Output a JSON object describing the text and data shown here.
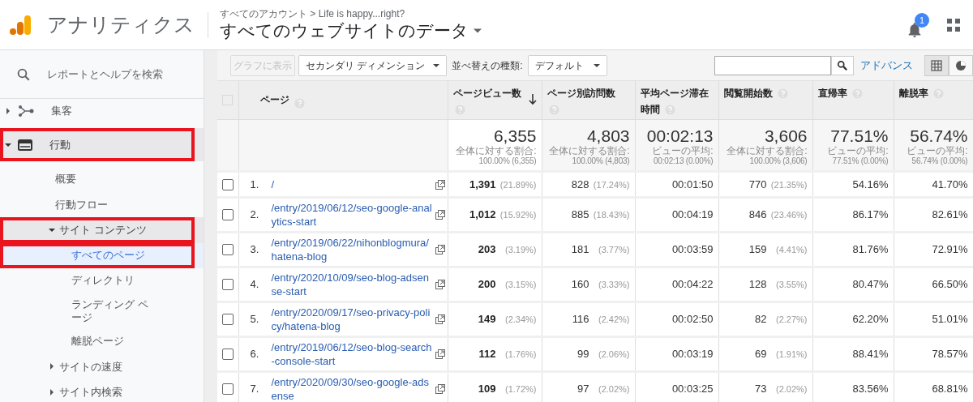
{
  "header": {
    "app_name": "アナリティクス",
    "breadcrumb": "すべてのアカウント > Life is happy...right?",
    "view_title": "すべてのウェブサイトのデータ",
    "notification_count": "1"
  },
  "sidebar": {
    "search": {
      "placeholder": "レポートとヘルプを検索"
    },
    "items": [
      {
        "label": "集客",
        "expanded": false,
        "selected": false,
        "highlighted": false
      },
      {
        "label": "行動",
        "expanded": true,
        "selected": false,
        "highlighted": true,
        "children": [
          {
            "label": "概要",
            "selected": false,
            "highlighted": false
          },
          {
            "label": "行動フロー",
            "selected": false,
            "highlighted": false
          },
          {
            "label": "サイト コンテンツ",
            "expanded": true,
            "selected": false,
            "highlighted": true,
            "children": [
              {
                "label": "すべてのページ",
                "selected": true,
                "highlighted": true
              },
              {
                "label": "ディレクトリ",
                "selected": false,
                "highlighted": false
              },
              {
                "label": "ランディング ページ",
                "selected": false,
                "highlighted": false
              },
              {
                "label": "離脱ページ",
                "selected": false,
                "highlighted": false
              }
            ]
          },
          {
            "label": "サイトの速度",
            "expanded": false,
            "selected": false,
            "highlighted": false
          },
          {
            "label": "サイト内検索",
            "expanded": false,
            "selected": false,
            "highlighted": false
          }
        ]
      }
    ]
  },
  "toolbar": {
    "chart_button": {
      "label": "グラフに表示",
      "disabled": true
    },
    "secondary_dimension": "セカンダリ ディメンション",
    "sort_label": "並べ替えの種類:",
    "sort_value": "デフォルト",
    "advanced_link": "アドバンス",
    "views": [
      {
        "kind": "table",
        "selected": true
      },
      {
        "kind": "pie",
        "selected": false
      }
    ]
  },
  "table": {
    "select_all_checked": false,
    "columns": [
      {
        "label": "ページ",
        "sorted": false
      },
      {
        "label": "ページビュー数",
        "sorted": true
      },
      {
        "label": "ページ別訪問数",
        "sorted": false
      },
      {
        "label": "平均ページ滞在時間",
        "sorted": false
      },
      {
        "label": "閲覧開始数",
        "sorted": false
      },
      {
        "label": "直帰率",
        "sorted": false
      },
      {
        "label": "離脱率",
        "sorted": false
      }
    ],
    "totals": [
      {
        "value": "6,355",
        "caption": "全体に対する割合:",
        "detail": "100.00% (6,355)"
      },
      {
        "value": "4,803",
        "caption": "全体に対する割合:",
        "detail": "100.00% (4,803)"
      },
      {
        "value": "00:02:13",
        "caption": "ビューの平均:",
        "detail": "00:02:13 (0.00%)"
      },
      {
        "value": "3,606",
        "caption": "全体に対する割合:",
        "detail": "100.00% (3,606)"
      },
      {
        "value": "77.51%",
        "caption": "ビューの平均:",
        "detail": "77.51% (0.00%)"
      },
      {
        "value": "56.74%",
        "caption": "ビューの平均:",
        "detail": "56.74% (0.00%)"
      }
    ],
    "rows": [
      {
        "checked": false,
        "index": "1.",
        "page": "/",
        "pageviews": "1,391",
        "pageviews_share": "(21.89%)",
        "unique": "828",
        "unique_share": "(17.24%)",
        "avg_time": "00:01:50",
        "entrances": "770",
        "entrances_share": "(21.35%)",
        "bounce_rate": "54.16%",
        "exit_rate": "41.70%"
      },
      {
        "checked": false,
        "index": "2.",
        "page": "/entry/2019/06/12/seo-google-analytics-start",
        "pageviews": "1,012",
        "pageviews_share": "(15.92%)",
        "unique": "885",
        "unique_share": "(18.43%)",
        "avg_time": "00:04:19",
        "entrances": "846",
        "entrances_share": "(23.46%)",
        "bounce_rate": "86.17%",
        "exit_rate": "82.61%"
      },
      {
        "checked": false,
        "index": "3.",
        "page": "/entry/2019/06/22/nihonblogmura/hatena-blog",
        "pageviews": "203",
        "pageviews_share": "(3.19%)",
        "unique": "181",
        "unique_share": "(3.77%)",
        "avg_time": "00:03:59",
        "entrances": "159",
        "entrances_share": "(4.41%)",
        "bounce_rate": "81.76%",
        "exit_rate": "72.91%"
      },
      {
        "checked": false,
        "index": "4.",
        "page": "/entry/2020/10/09/seo-blog-adsense-start",
        "pageviews": "200",
        "pageviews_share": "(3.15%)",
        "unique": "160",
        "unique_share": "(3.33%)",
        "avg_time": "00:04:22",
        "entrances": "128",
        "entrances_share": "(3.55%)",
        "bounce_rate": "80.47%",
        "exit_rate": "66.50%"
      },
      {
        "checked": false,
        "index": "5.",
        "page": "/entry/2020/09/17/seo-privacy-policy/hatena-blog",
        "pageviews": "149",
        "pageviews_share": "(2.34%)",
        "unique": "116",
        "unique_share": "(2.42%)",
        "avg_time": "00:02:50",
        "entrances": "82",
        "entrances_share": "(2.27%)",
        "bounce_rate": "62.20%",
        "exit_rate": "51.01%"
      },
      {
        "checked": false,
        "index": "6.",
        "page": "/entry/2019/06/12/seo-blog-search-console-start",
        "pageviews": "112",
        "pageviews_share": "(1.76%)",
        "unique": "99",
        "unique_share": "(2.06%)",
        "avg_time": "00:03:19",
        "entrances": "69",
        "entrances_share": "(1.91%)",
        "bounce_rate": "88.41%",
        "exit_rate": "78.57%"
      },
      {
        "checked": false,
        "index": "7.",
        "page": "/entry/2020/09/30/seo-google-adsense",
        "pageviews": "109",
        "pageviews_share": "(1.72%)",
        "unique": "97",
        "unique_share": "(2.02%)",
        "avg_time": "00:03:25",
        "entrances": "73",
        "entrances_share": "(2.02%)",
        "bounce_rate": "83.56%",
        "exit_rate": "68.81%"
      }
    ]
  }
}
